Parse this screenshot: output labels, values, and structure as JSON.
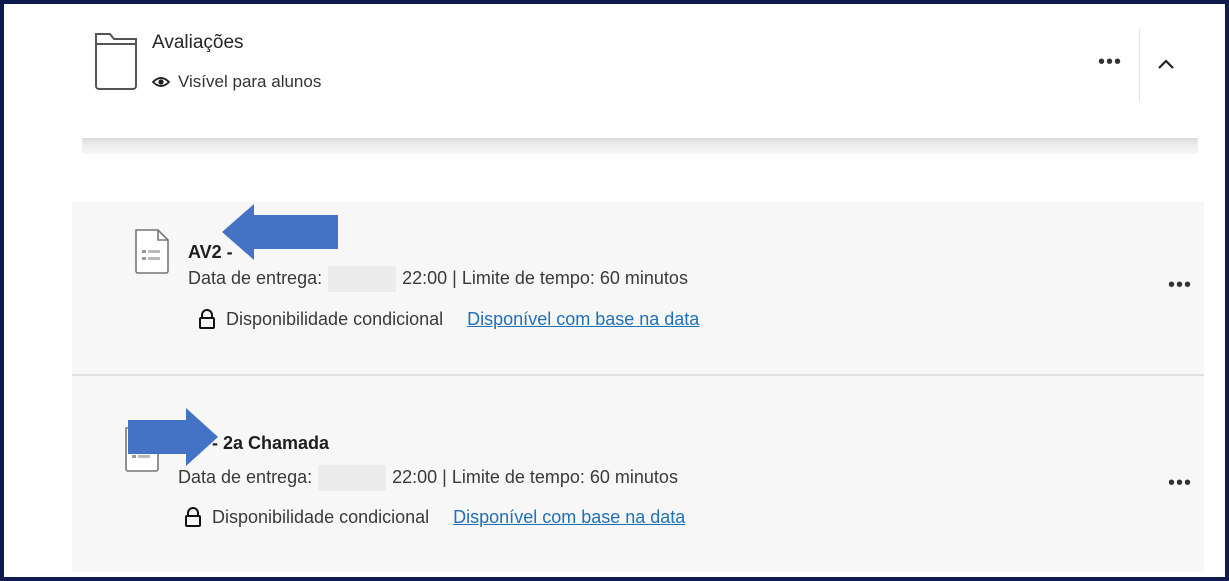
{
  "folder": {
    "title": "Avaliações",
    "visibility": "Visível para alunos",
    "more_label": "•••"
  },
  "items": [
    {
      "title": "AV2 -",
      "due_label": "Data de entrega:",
      "due_time": "22:00 | Limite de tempo: 60 minutos",
      "condition_label": "Disponibilidade condicional",
      "condition_link": "Disponível com base na data",
      "more_label": "•••"
    },
    {
      "title": "- 2a Chamada",
      "due_label": "Data de entrega:",
      "due_time": "22:00 | Limite de tempo: 60 minutos",
      "condition_label": "Disponibilidade condicional",
      "condition_link": "Disponível com base na data",
      "more_label": "•••"
    }
  ],
  "colors": {
    "frame_border": "#0f1b4c",
    "arrow": "#4472c4",
    "link": "#2170b8",
    "item_bg": "#f7f7f7"
  },
  "icons": [
    "folder-icon",
    "eye-icon",
    "collapse-chevron-icon",
    "document-icon",
    "lock-icon",
    "arrow-left-icon",
    "arrow-right-icon"
  ]
}
